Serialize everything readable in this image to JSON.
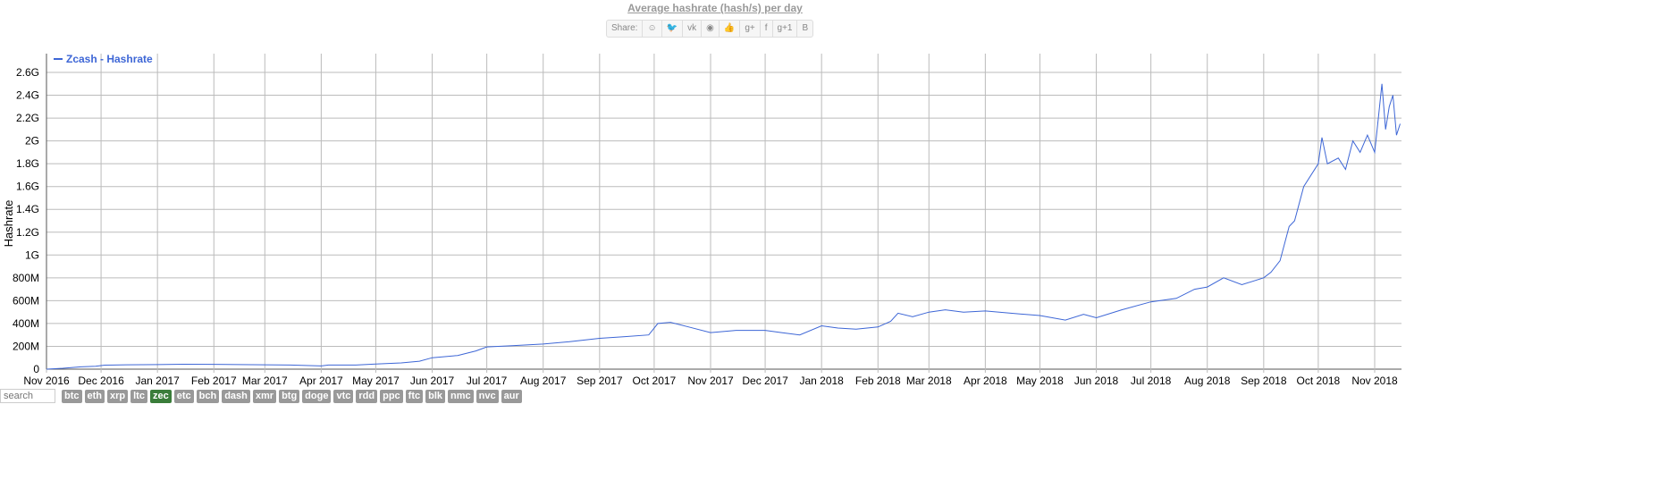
{
  "title": "Average hashrate (hash/s) per day",
  "share": {
    "label": "Share:",
    "icons": [
      "reddit-icon",
      "twitter-icon",
      "vk-icon",
      "weibo-icon",
      "like-icon",
      "google-plus-icon",
      "facebook-icon",
      "google-plus-one-icon",
      "blogger-icon"
    ],
    "glyphs": [
      "☺",
      "🐦",
      "vk",
      "◉",
      "👍",
      "g+",
      "f",
      "g+1",
      "B"
    ]
  },
  "chart_data": {
    "type": "line",
    "title": "Average hashrate (hash/s) per day",
    "ylabel": "Hashrate",
    "xlabel": "",
    "legend": {
      "position": "top-left",
      "entries": [
        "Zcash - Hashrate"
      ]
    },
    "series": [
      {
        "name": "Zcash - Hashrate",
        "color": "#3d66d6",
        "points": [
          [
            "2016-11-01",
            0
          ],
          [
            "2016-11-10",
            8
          ],
          [
            "2016-11-20",
            20
          ],
          [
            "2016-11-28",
            25
          ],
          [
            "2016-12-03",
            35
          ],
          [
            "2016-12-15",
            38
          ],
          [
            "2017-01-01",
            40
          ],
          [
            "2017-01-15",
            43
          ],
          [
            "2017-02-01",
            42
          ],
          [
            "2017-02-15",
            40
          ],
          [
            "2017-03-01",
            38
          ],
          [
            "2017-03-15",
            36
          ],
          [
            "2017-04-01",
            28
          ],
          [
            "2017-04-05",
            36
          ],
          [
            "2017-04-20",
            36
          ],
          [
            "2017-05-01",
            45
          ],
          [
            "2017-05-15",
            55
          ],
          [
            "2017-05-25",
            70
          ],
          [
            "2017-06-01",
            100
          ],
          [
            "2017-06-15",
            120
          ],
          [
            "2017-06-25",
            160
          ],
          [
            "2017-07-01",
            195
          ],
          [
            "2017-07-15",
            205
          ],
          [
            "2017-08-01",
            220
          ],
          [
            "2017-08-15",
            240
          ],
          [
            "2017-09-01",
            270
          ],
          [
            "2017-09-15",
            285
          ],
          [
            "2017-09-28",
            300
          ],
          [
            "2017-10-03",
            400
          ],
          [
            "2017-10-10",
            410
          ],
          [
            "2017-10-20",
            370
          ],
          [
            "2017-11-01",
            320
          ],
          [
            "2017-11-15",
            340
          ],
          [
            "2017-12-01",
            340
          ],
          [
            "2017-12-10",
            320
          ],
          [
            "2017-12-20",
            300
          ],
          [
            "2018-01-01",
            380
          ],
          [
            "2018-01-10",
            360
          ],
          [
            "2018-01-20",
            350
          ],
          [
            "2018-02-01",
            370
          ],
          [
            "2018-02-08",
            420
          ],
          [
            "2018-02-12",
            490
          ],
          [
            "2018-02-20",
            460
          ],
          [
            "2018-03-01",
            500
          ],
          [
            "2018-03-10",
            520
          ],
          [
            "2018-03-20",
            500
          ],
          [
            "2018-04-01",
            510
          ],
          [
            "2018-04-15",
            490
          ],
          [
            "2018-05-01",
            470
          ],
          [
            "2018-05-15",
            430
          ],
          [
            "2018-05-25",
            480
          ],
          [
            "2018-06-01",
            450
          ],
          [
            "2018-06-15",
            520
          ],
          [
            "2018-07-01",
            590
          ],
          [
            "2018-07-15",
            620
          ],
          [
            "2018-07-25",
            700
          ],
          [
            "2018-08-01",
            720
          ],
          [
            "2018-08-10",
            800
          ],
          [
            "2018-08-20",
            740
          ],
          [
            "2018-09-01",
            800
          ],
          [
            "2018-09-05",
            850
          ],
          [
            "2018-09-10",
            950
          ],
          [
            "2018-09-15",
            1250
          ],
          [
            "2018-09-18",
            1300
          ],
          [
            "2018-09-23",
            1600
          ],
          [
            "2018-10-01",
            1800
          ],
          [
            "2018-10-03",
            2030
          ],
          [
            "2018-10-06",
            1800
          ],
          [
            "2018-10-12",
            1850
          ],
          [
            "2018-10-16",
            1750
          ],
          [
            "2018-10-20",
            2000
          ],
          [
            "2018-10-24",
            1900
          ],
          [
            "2018-10-28",
            2050
          ],
          [
            "2018-11-01",
            1900
          ],
          [
            "2018-11-03",
            2200
          ],
          [
            "2018-11-05",
            2500
          ],
          [
            "2018-11-07",
            2100
          ],
          [
            "2018-11-09",
            2300
          ],
          [
            "2018-11-11",
            2400
          ],
          [
            "2018-11-13",
            2050
          ],
          [
            "2018-11-15",
            2150
          ]
        ]
      }
    ],
    "yticks": [
      {
        "v": 0,
        "label": "0"
      },
      {
        "v": 200,
        "label": "200M"
      },
      {
        "v": 400,
        "label": "400M"
      },
      {
        "v": 600,
        "label": "600M"
      },
      {
        "v": 800,
        "label": "800M"
      },
      {
        "v": 1000,
        "label": "1G"
      },
      {
        "v": 1200,
        "label": "1.2G"
      },
      {
        "v": 1400,
        "label": "1.4G"
      },
      {
        "v": 1600,
        "label": "1.6G"
      },
      {
        "v": 1800,
        "label": "1.8G"
      },
      {
        "v": 2000,
        "label": "2G"
      },
      {
        "v": 2200,
        "label": "2.2G"
      },
      {
        "v": 2400,
        "label": "2.4G"
      },
      {
        "v": 2600,
        "label": "2.6G"
      }
    ],
    "yunit": "M hash/s",
    "xticks": [
      [
        "2016-11-01",
        "Nov 2016"
      ],
      [
        "2016-12-01",
        "Dec 2016"
      ],
      [
        "2017-01-01",
        "Jan 2017"
      ],
      [
        "2017-02-01",
        "Feb 2017"
      ],
      [
        "2017-03-01",
        "Mar 2017"
      ],
      [
        "2017-04-01",
        "Apr 2017"
      ],
      [
        "2017-05-01",
        "May 2017"
      ],
      [
        "2017-06-01",
        "Jun 2017"
      ],
      [
        "2017-07-01",
        "Jul 2017"
      ],
      [
        "2017-08-01",
        "Aug 2017"
      ],
      [
        "2017-09-01",
        "Sep 2017"
      ],
      [
        "2017-10-01",
        "Oct 2017"
      ],
      [
        "2017-11-01",
        "Nov 2017"
      ],
      [
        "2017-12-01",
        "Dec 2017"
      ],
      [
        "2018-01-01",
        "Jan 2018"
      ],
      [
        "2018-02-01",
        "Feb 2018"
      ],
      [
        "2018-03-01",
        "Mar 2018"
      ],
      [
        "2018-04-01",
        "Apr 2018"
      ],
      [
        "2018-05-01",
        "May 2018"
      ],
      [
        "2018-06-01",
        "Jun 2018"
      ],
      [
        "2018-07-01",
        "Jul 2018"
      ],
      [
        "2018-08-01",
        "Aug 2018"
      ],
      [
        "2018-09-01",
        "Sep 2018"
      ],
      [
        "2018-10-01",
        "Oct 2018"
      ],
      [
        "2018-11-01",
        "Nov 2018"
      ]
    ],
    "xlim": [
      "2016-11-01",
      "2018-11-15"
    ],
    "ylim": [
      0,
      2600
    ],
    "grid": true
  },
  "footer": {
    "search_placeholder": "search",
    "coins": [
      "btc",
      "eth",
      "xrp",
      "ltc",
      "zec",
      "etc",
      "bch",
      "dash",
      "xmr",
      "btg",
      "doge",
      "vtc",
      "rdd",
      "ppc",
      "ftc",
      "blk",
      "nmc",
      "nvc",
      "aur"
    ],
    "active": "zec",
    "active_color": "#3a7d3a"
  }
}
